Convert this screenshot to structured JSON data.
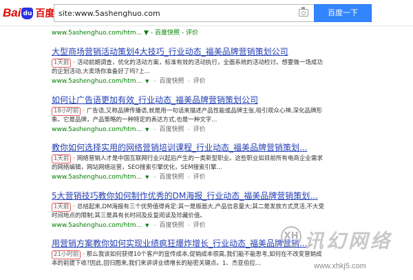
{
  "header": {
    "logo_bai": "Bai",
    "logo_du": "du",
    "logo_cn": "百度",
    "search_value": "site:www.5ashenghuo.com",
    "search_button": "百度一下",
    "camera_icon": "camera-icon"
  },
  "top_line": {
    "url": "www.5ashenghuo.com/htm...",
    "snapshot": "百度快照",
    "eval": "评价"
  },
  "results": [
    {
      "title": "大型商场营销活动策划4大技巧_行业动态_福美品牌营销策划公司",
      "time": "1天前",
      "abstract": "· 活动前期调查，优化的活动方案，标准有效的活动执行，全面系统的活动检讨。想要做一场成功的企划活动,大卖场你准备好了吗?上...",
      "url": "www.5ashenghuo.com/htm...",
      "snapshot": "百度快照",
      "eval": "评价"
    },
    {
      "title": "如何让广告语更加有效_行业动态_福美品牌营销策划公司",
      "time": "18小时前",
      "abstract": "· 广告语,又称品牌传播语,就是用一句话来描述产品性能或品牌主张,吸引观众心神,深化品牌形象。它是品牌，产品策略的一种特定的表达方式,也是一种文字...",
      "url": "www.5ashenghuo.com/htm...",
      "snapshot": "百度快照",
      "eval": "评价"
    },
    {
      "title": "教你如何选择实用的网络营销培训课程_行业动态_福美品牌营销策划...",
      "time": "1天前",
      "abstract": "· 网络营销人才是中国互联网行业兴起后产生的一类新型职业。这些职业如目前所有电商企业需求的网络编辑，网站网络运营，SEO搜索引擎优化，SEM搜索引擎...",
      "url": "www.5ashenghuo.com/htm...",
      "snapshot": "百度快照",
      "eval": "评价"
    },
    {
      "title": "5大营销技巧教你如何制作优秀的DM海报_行业动态_福美品牌营销策划...",
      "time": "1天前",
      "abstract": "· 总结起来,DM海报有三个优势值得肯定:其一是版面大,产品信息量大;其二是发放方式灵活,不大受时间地点的限制;其三是具有长时间及反复阅读及珍藏价值。",
      "url": "www.5ashenghuo.com/htm...",
      "snapshot": "百度快照",
      "eval": "评价"
    },
    {
      "title": "用营销方案教你如何实现业绩疯狂爆炸增长_行业动态_福美品牌营销...",
      "time": "21小时前",
      "abstract": "· 那么我该如何获得10个客户的宣传成本,促销成本很高,我们能不能思考,如何在不改变营销成本的前提下收?因此,回归图来,我们来讲讲业绩增长的秘密关键点。1、杰亚伯拉...",
      "url": "www.5ashenghuo.com/htm...",
      "snapshot": "百度快照",
      "eval": "评价"
    }
  ],
  "watermark": {
    "logo": "XH",
    "text": "讯幻网络",
    "url": "www.xhkj5.com"
  }
}
